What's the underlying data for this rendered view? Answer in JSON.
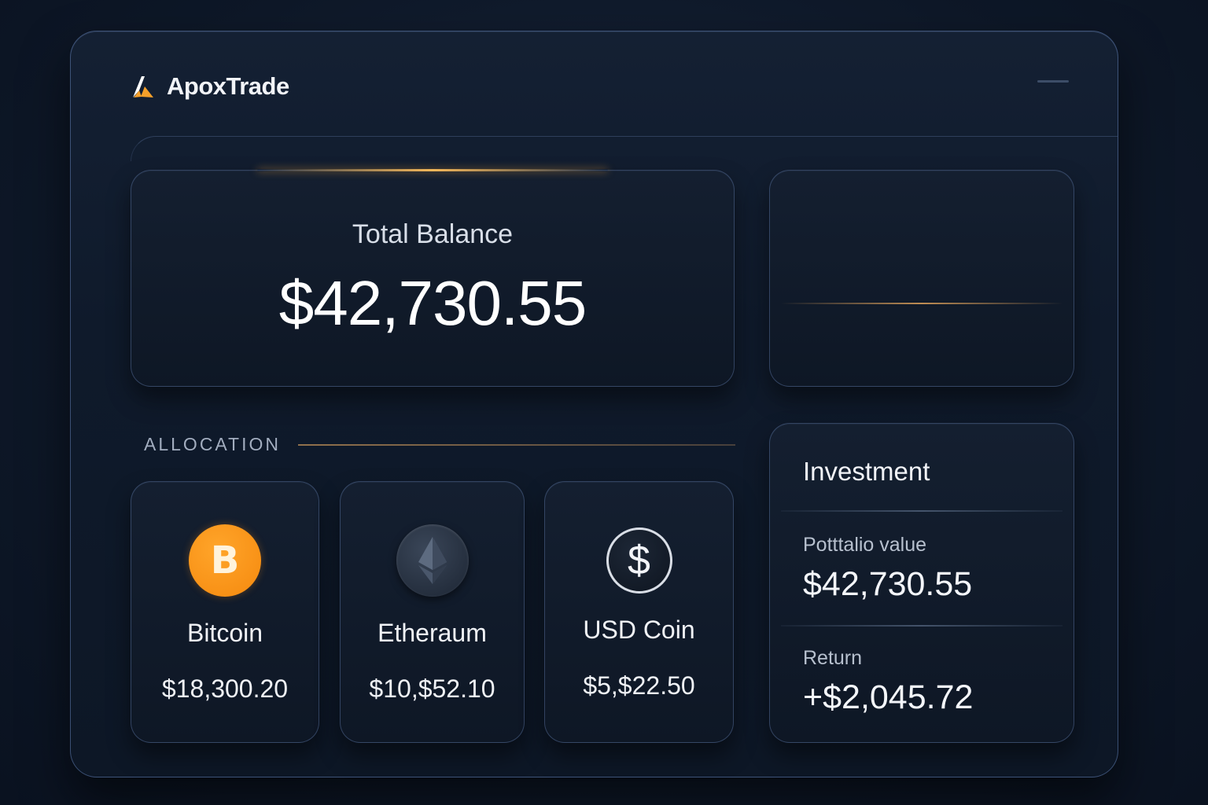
{
  "app": {
    "name": "ApoxTrade",
    "logo_icon": "apex-logo-icon",
    "menu_icon": "menu-icon"
  },
  "colors": {
    "accent": "#f5a02a",
    "bitcoin": "#f5890e",
    "background": "#0e1828",
    "card": "#121c2c"
  },
  "balance": {
    "label": "Total Balance",
    "value": "$42,730.55"
  },
  "allocation": {
    "title": "ALLOCATION",
    "coins": [
      {
        "name": "Bitcoin",
        "value": "$18,300.20",
        "icon": "bitcoin-icon"
      },
      {
        "name": "Etheraum",
        "value": "$10,$52.10",
        "icon": "ethereum-icon"
      },
      {
        "name": "USD Coin",
        "value": "$5,$22.50",
        "icon": "usd-coin-icon"
      }
    ]
  },
  "investment": {
    "title": "Investment",
    "portfolio_label": "Potttalio value",
    "portfolio_value": "$42,730.55",
    "return_label": "Return",
    "return_value": "+$2,045.72"
  }
}
